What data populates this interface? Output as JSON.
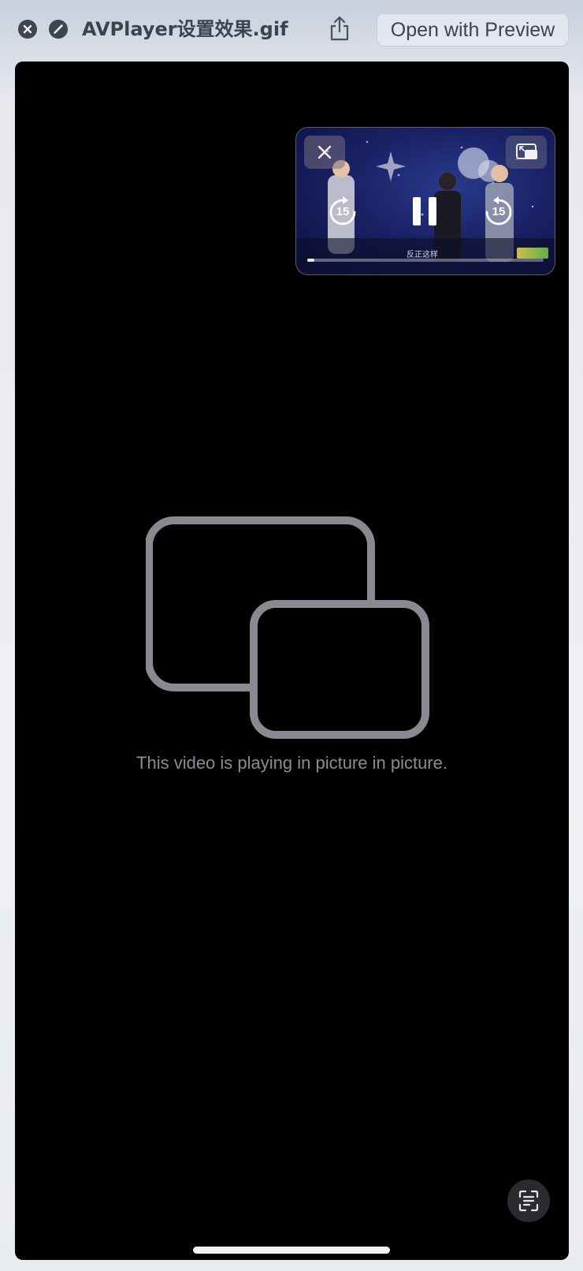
{
  "window": {
    "title": "AVPlayer设置效果.gif",
    "open_with_label": "Open with Preview",
    "icons": {
      "close": "close-circle-icon",
      "block": "disable-circle-icon",
      "share": "share-icon"
    }
  },
  "player": {
    "message": "This video is playing in picture in picture.",
    "placeholder_icon": "picture-in-picture-icon",
    "pip": {
      "skip_back_seconds": "15",
      "skip_forward_seconds": "15",
      "subtitle": "反正这样",
      "progress": 0.03,
      "icons": {
        "close": "close-icon",
        "restore": "pip-restore-icon",
        "skip_back": "skip-back-15-icon",
        "pause": "pause-icon",
        "skip_forward": "skip-forward-15-icon"
      }
    },
    "live_text_icon": "live-text-icon"
  },
  "colors": {
    "screen_background": "#020102",
    "placeholder_stroke": "#8a898f",
    "message_text": "#8c8b92",
    "title_text": "#3d434e"
  }
}
